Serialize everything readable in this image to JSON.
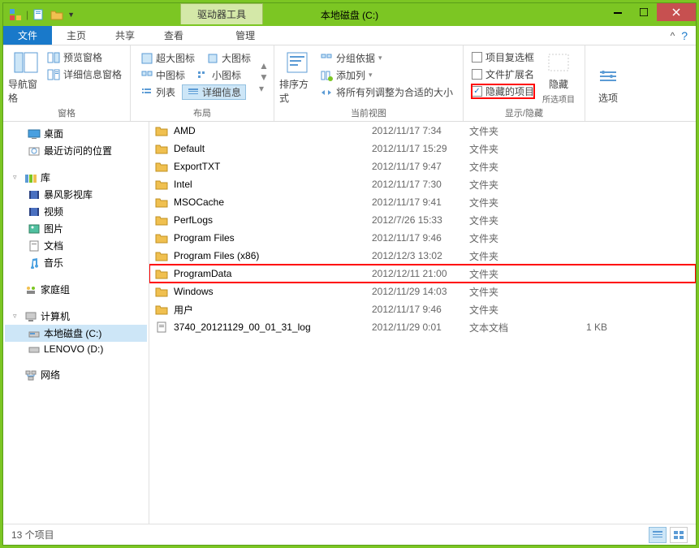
{
  "title": "本地磁盘 (C:)",
  "tool_tab": "驱动器工具",
  "tabs": {
    "file": "文件",
    "home": "主页",
    "share": "共享",
    "view": "查看",
    "manage": "管理"
  },
  "ribbon": {
    "nav_pane": "导航窗格",
    "preview_pane": "预览窗格",
    "details_pane": "详细信息窗格",
    "group_panes": "窗格",
    "extra_large": "超大图标",
    "large": "大图标",
    "medium": "中图标",
    "small": "小图标",
    "list": "列表",
    "details": "详细信息",
    "group_layout": "布局",
    "sort_by": "排序方式",
    "group_by": "分组依据",
    "add_columns": "添加列",
    "fit_columns": "将所有列调整为合适的大小",
    "group_current": "当前视图",
    "item_checkboxes": "项目复选框",
    "file_ext": "文件扩展名",
    "hidden_items": "隐藏的项目",
    "hide_selected": "隐藏所选项目",
    "hide_selected_short": "隐藏",
    "group_showhide": "显示/隐藏",
    "options": "选项"
  },
  "sidebar": {
    "desktop": "桌面",
    "recent": "最近访问的位置",
    "libraries": "库",
    "storm": "暴风影视库",
    "videos": "视频",
    "pictures": "图片",
    "documents": "文档",
    "music": "音乐",
    "homegroup": "家庭组",
    "computer": "计算机",
    "cdrive": "本地磁盘 (C:)",
    "ddrive": "LENOVO (D:)",
    "network": "网络"
  },
  "files": [
    {
      "name": "AMD",
      "date": "2012/11/17 7:34",
      "type": "文件夹",
      "size": "",
      "folder": true
    },
    {
      "name": "Default",
      "date": "2012/11/17 15:29",
      "type": "文件夹",
      "size": "",
      "folder": true
    },
    {
      "name": "ExportTXT",
      "date": "2012/11/17 9:47",
      "type": "文件夹",
      "size": "",
      "folder": true
    },
    {
      "name": "Intel",
      "date": "2012/11/17 7:30",
      "type": "文件夹",
      "size": "",
      "folder": true
    },
    {
      "name": "MSOCache",
      "date": "2012/11/17 9:41",
      "type": "文件夹",
      "size": "",
      "folder": true
    },
    {
      "name": "PerfLogs",
      "date": "2012/7/26 15:33",
      "type": "文件夹",
      "size": "",
      "folder": true
    },
    {
      "name": "Program Files",
      "date": "2012/11/17 9:46",
      "type": "文件夹",
      "size": "",
      "folder": true
    },
    {
      "name": "Program Files (x86)",
      "date": "2012/12/3 13:02",
      "type": "文件夹",
      "size": "",
      "folder": true
    },
    {
      "name": "ProgramData",
      "date": "2012/12/11 21:00",
      "type": "文件夹",
      "size": "",
      "folder": true,
      "highlight": true
    },
    {
      "name": "Windows",
      "date": "2012/11/29 14:03",
      "type": "文件夹",
      "size": "",
      "folder": true
    },
    {
      "name": "用户",
      "date": "2012/11/17 9:46",
      "type": "文件夹",
      "size": "",
      "folder": true
    },
    {
      "name": "3740_20121129_00_01_31_log",
      "date": "2012/11/29 0:01",
      "type": "文本文档",
      "size": "1 KB",
      "folder": false
    }
  ],
  "status": "13 个项目"
}
